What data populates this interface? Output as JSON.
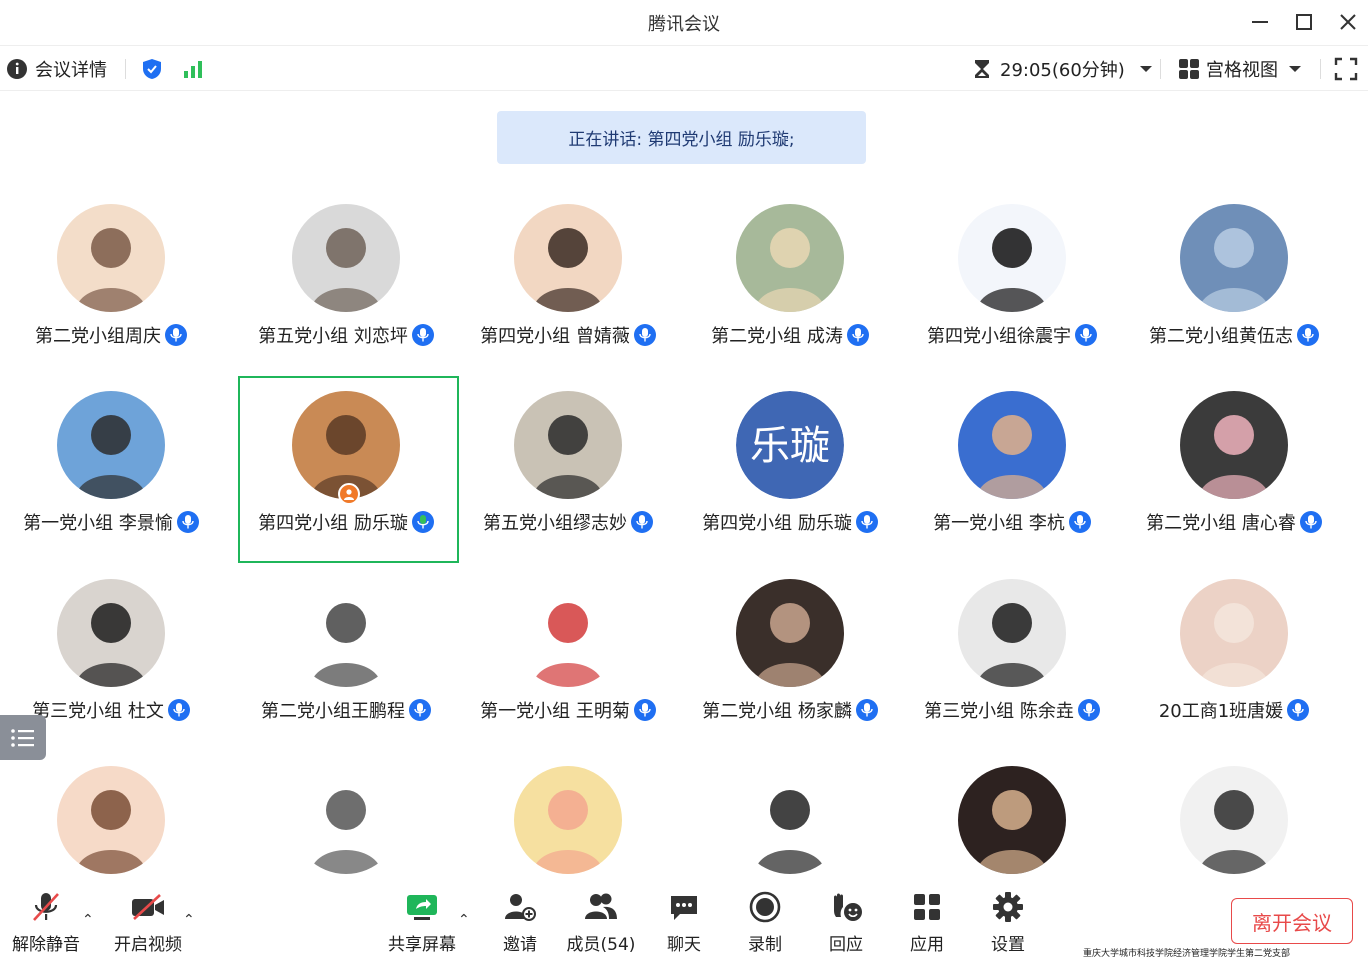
{
  "window": {
    "title": "腾讯会议"
  },
  "infobar": {
    "details_label": "会议详情",
    "timer": "29:05(60分钟)",
    "view_label": "宫格视图"
  },
  "banner": {
    "text": "正在讲话: 第四党小组 励乐璇;"
  },
  "participants": [
    {
      "name": "第二党小组周庆"
    },
    {
      "name": "第五党小组  刘恋坪"
    },
    {
      "name": "第四党小组 曾婧薇"
    },
    {
      "name": "第二党小组 成涛"
    },
    {
      "name": "第四党小组徐震宇"
    },
    {
      "name": "第二党小组黄伍志"
    },
    {
      "name": "第一党小组 李景愉"
    },
    {
      "name": "第四党小组 励乐璇"
    },
    {
      "name": "第五党小组缪志妙"
    },
    {
      "name": "第四党小组 励乐璇",
      "avatar_text": "乐璇"
    },
    {
      "name": "第一党小组 李杭"
    },
    {
      "name": "第二党小组 唐心睿"
    },
    {
      "name": "第三党小组 杜文"
    },
    {
      "name": "第二党小组王鹏程"
    },
    {
      "name": "第一党小组 王明菊"
    },
    {
      "name": "第二党小组 杨家麟"
    },
    {
      "name": "第三党小组 陈余垚"
    },
    {
      "name": "20工商1班唐媛"
    }
  ],
  "toolbar": {
    "unmute": "解除静音",
    "start_video": "开启视频",
    "share_screen": "共享屏幕",
    "invite": "邀请",
    "members": "成员(54)",
    "chat": "聊天",
    "record": "录制",
    "react": "回应",
    "apps": "应用",
    "settings": "设置",
    "leave": "离开会议"
  },
  "footnote": "重庆大学城市科技学院经济管理学院学生第二党支部",
  "colors": {
    "accent": "#1f6ff2",
    "leave": "#e84a4a",
    "speaking": "#1fb65a",
    "banner": "#dbe8fb"
  }
}
